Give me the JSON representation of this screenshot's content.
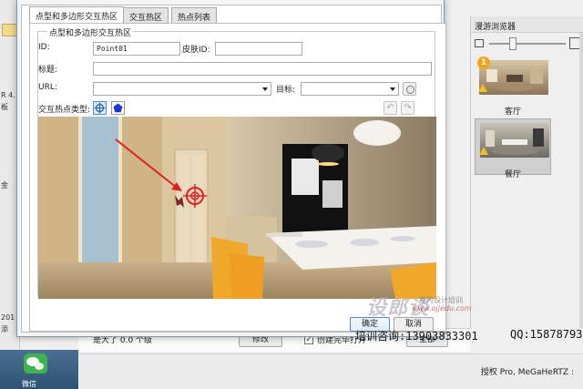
{
  "dialog": {
    "tabs": [
      {
        "label": "点型和多边形交互热区"
      },
      {
        "label": "交互热区"
      },
      {
        "label": "热点列表"
      }
    ],
    "group_title": "点型和多边形交互热区",
    "id_label": "ID:",
    "id_value": "Point01",
    "skin_id_label": "皮肤ID:",
    "skin_id_value": "",
    "title_label": "标题:",
    "title_value": "",
    "url_label": "URL:",
    "url_value": "",
    "target_label": "目标:",
    "target_value": "",
    "type_label": "交互热点类型:",
    "confirm_label": "确定",
    "cancel_label": "取消"
  },
  "browser": {
    "title": "漫游浏览器",
    "thumbnails": [
      {
        "name": "客厅",
        "badge": "1",
        "selected": false
      },
      {
        "name": "餐厅",
        "badge": "",
        "selected": true
      }
    ]
  },
  "background": {
    "left_strip": [
      "R 4.",
      "板",
      "金",
      "201",
      "添"
    ],
    "row_label": "是大了 0.0 个级",
    "edit_label": "修改",
    "checkbox_mark": "✓",
    "checkbox_label": "创建完毕打开",
    "all_label": "全部",
    "license": "授权 Pro, MeGaHeRTZ :",
    "taskbar_label": "微信"
  },
  "overlay": {
    "logo": "设郎谈",
    "site": "www.ojjedu.com",
    "cn_label": "室内设计培训",
    "training": "培训咨询:13903833301",
    "qq": "QQ:15878793"
  },
  "colors": {
    "accent": "#4f8fd6",
    "hotspot": "#e02020",
    "arrow": "#e02020",
    "chair": "#f0a82a",
    "warning": "#f0c020"
  },
  "icons": {
    "crosshair": "crosshair-icon",
    "polygon": "pentagon-icon",
    "warning": "warning-triangle-icon"
  }
}
